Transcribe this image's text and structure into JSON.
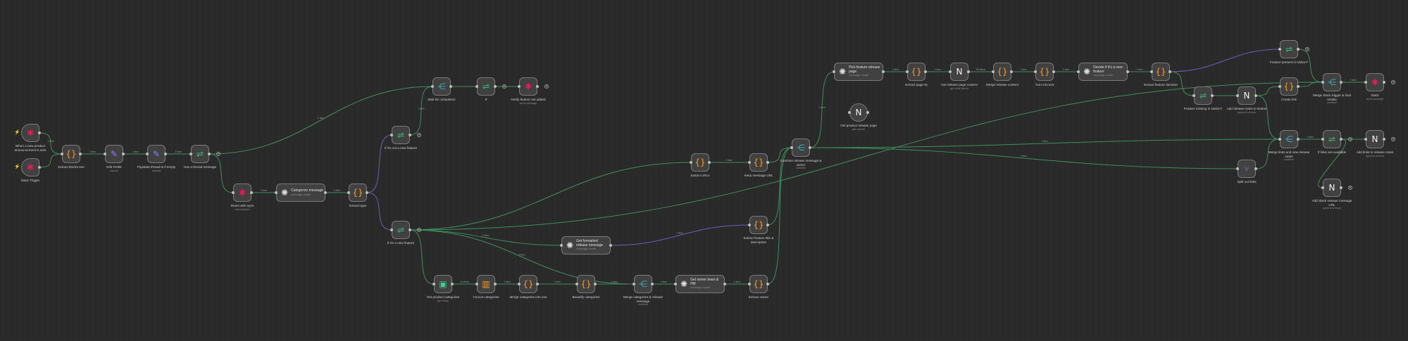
{
  "canvas": {
    "background": "#2a2a2a"
  },
  "colors": {
    "main": "#3f8f5e",
    "ai": "#6b5fb8",
    "node_border": "#7a7a7a"
  },
  "nodes": [
    {
      "id": "trig_new",
      "title": "When a new product announcement is sent",
      "icon": "slack-icon",
      "glyph": "✱",
      "color": "#e01e5a",
      "shape": "trigger"
    },
    {
      "id": "trig_slack",
      "title": "Slack Trigger",
      "icon": "slack-icon",
      "glyph": "✱",
      "color": "#e01e5a",
      "shape": "trigger"
    },
    {
      "id": "extract_blocks",
      "title": "Extract blocks text",
      "icon": "code-icon",
      "glyph": "{}",
      "color": "#ff9922"
    },
    {
      "id": "edit_fields",
      "title": "Edit Fields",
      "sub": "manual",
      "icon": "pencil-icon",
      "glyph": "✎",
      "color": "#8a7cff"
    },
    {
      "id": "populate_thread",
      "title": "Populate thread ts if empty",
      "sub": "manual",
      "icon": "pencil-icon",
      "glyph": "✎",
      "color": "#8a7cff"
    },
    {
      "id": "has_thread",
      "title": "Has a thread message",
      "icon": "if-icon",
      "glyph": "⇌",
      "color": "#35c07a"
    },
    {
      "id": "react_eyes",
      "title": "React with eyes",
      "sub": "add reaction",
      "icon": "slack-icon",
      "glyph": "✱",
      "color": "#e01e5a"
    },
    {
      "id": "categorize",
      "title": "Categorize message",
      "sub": "message model",
      "icon": "openai-icon",
      "glyph": "✺",
      "color": "#e0e0e0",
      "shape": "wide"
    },
    {
      "id": "extract_type",
      "title": "Extract type",
      "icon": "code-icon",
      "glyph": "{}",
      "color": "#ff9922"
    },
    {
      "id": "if_not_new",
      "title": "If it's not a new feature",
      "icon": "if-icon",
      "glyph": "⇌",
      "color": "#35c07a"
    },
    {
      "id": "if_new",
      "title": "If it's a new feature",
      "icon": "if-icon",
      "glyph": "⇌",
      "color": "#35c07a"
    },
    {
      "id": "wait",
      "title": "Wait for completion",
      "icon": "merge-icon",
      "glyph": "⋲",
      "color": "#35b5c0"
    },
    {
      "id": "if_plain",
      "title": "If",
      "icon": "if-icon",
      "glyph": "⇌",
      "color": "#35c07a"
    },
    {
      "id": "notify_not_added",
      "title": "Notify feature not added",
      "sub": "send message",
      "icon": "slack-icon",
      "glyph": "✱",
      "color": "#e01e5a"
    },
    {
      "id": "get_categories",
      "title": "Get product categories",
      "sub": "get many",
      "icon": "db-icon",
      "glyph": "▣",
      "color": "#3ecf8e"
    },
    {
      "id": "concat_categories",
      "title": "Concat categories",
      "icon": "aggregate-icon",
      "glyph": "▥",
      "color": "#ff9922"
    },
    {
      "id": "merge_cat_one",
      "title": "Merge categories into one",
      "icon": "code-icon",
      "glyph": "{}",
      "color": "#ff9922"
    },
    {
      "id": "beautify_categories",
      "title": "Beautify categories",
      "icon": "code-icon",
      "glyph": "{}",
      "color": "#ff9922"
    },
    {
      "id": "merge_cat_release",
      "title": "Merge categories & release message",
      "sub": "combine",
      "icon": "merge-icon",
      "glyph": "⋲",
      "color": "#35b5c0"
    },
    {
      "id": "get_formatted",
      "title": "Get formatted release message",
      "sub": "message model",
      "icon": "openai-icon",
      "glyph": "✺",
      "color": "#e0e0e0",
      "shape": "wide"
    },
    {
      "id": "get_owner",
      "title": "Get owner team & PM",
      "sub": "message model",
      "icon": "openai-icon",
      "glyph": "✺",
      "color": "#e0e0e0",
      "shape": "wide"
    },
    {
      "id": "extract_owner",
      "title": "Extract owner",
      "icon": "code-icon",
      "glyph": "{}",
      "color": "#ff9922"
    },
    {
      "id": "extract_title_desc",
      "title": "Extract feature title & description",
      "icon": "code-icon",
      "glyph": "{}",
      "color": "#ff9922"
    },
    {
      "id": "extract_urls",
      "title": "Extract URLs",
      "icon": "code-icon",
      "glyph": "{}",
      "color": "#ff9922"
    },
    {
      "id": "keep_url",
      "title": "Keep message URL",
      "icon": "code-icon",
      "glyph": "{}",
      "color": "#ff9922"
    },
    {
      "id": "combine_release",
      "title": "Combine release message & owner",
      "sub": "combine",
      "icon": "merge-icon",
      "glyph": "⋲",
      "color": "#35b5c0"
    },
    {
      "id": "pick_feature",
      "title": "Pick feature release page",
      "sub": "message model",
      "icon": "openai-icon",
      "glyph": "✺",
      "color": "#e0e0e0",
      "shape": "wide"
    },
    {
      "id": "get_product_release",
      "title": "Get product release page",
      "sub": "get a block",
      "icon": "notion-icon",
      "glyph": "N",
      "color": "#f2f2f2",
      "shape": "circle"
    },
    {
      "id": "extract_page_id",
      "title": "Extract page ID",
      "icon": "code-icon",
      "glyph": "{}",
      "color": "#ff9922"
    },
    {
      "id": "get_release_content",
      "title": "Get release page content",
      "sub": "get child blocks",
      "icon": "notion-icon",
      "glyph": "N",
      "color": "#f2f2f2"
    },
    {
      "id": "merge_release_content",
      "title": "Merge release content",
      "icon": "code-icon",
      "glyph": "{}",
      "color": "#ff9922"
    },
    {
      "id": "turn_into_text",
      "title": "Turn into text",
      "icon": "code-icon",
      "glyph": "{}",
      "color": "#ff9922"
    },
    {
      "id": "decide_new",
      "title": "Decide if it's a new feature",
      "sub": "message model",
      "icon": "openai-icon",
      "glyph": "✺",
      "color": "#e0e0e0",
      "shape": "wide"
    },
    {
      "id": "extract_decision",
      "title": "Extract feature decision",
      "icon": "code-icon",
      "glyph": "{}",
      "color": "#ff9922"
    },
    {
      "id": "feature_present",
      "title": "Feature present in Notion?",
      "icon": "if-icon",
      "glyph": "⇌",
      "color": "#35c07a"
    },
    {
      "id": "feature_missing",
      "title": "Feature missing in Notion?",
      "icon": "if-icon",
      "glyph": "⇌",
      "color": "#35c07a"
    },
    {
      "id": "add_release_notes",
      "title": "Add release notes to Notion",
      "sub": "append a block",
      "icon": "notion-icon",
      "glyph": "N",
      "color": "#f2f2f2"
    },
    {
      "id": "create_link",
      "title": "Create link",
      "icon": "code-icon",
      "glyph": "{}",
      "color": "#ff9922"
    },
    {
      "id": "merge_slack_trigger",
      "title": "Merge Slack trigger & final results",
      "sub": "combine",
      "icon": "merge-icon",
      "glyph": "⋲",
      "color": "#35b5c0"
    },
    {
      "id": "slack_final",
      "title": "Slack",
      "sub": "send message",
      "icon": "slack-icon",
      "glyph": "✱",
      "color": "#e01e5a"
    },
    {
      "id": "split_links",
      "title": "Split out links",
      "icon": "split-icon",
      "glyph": "⑂",
      "color": "#8a7cff"
    },
    {
      "id": "merge_links",
      "title": "Merge links and new release notes",
      "sub": "combine",
      "icon": "merge-icon",
      "glyph": "⋲",
      "color": "#35b5c0"
    },
    {
      "id": "if_links",
      "title": "If links are available",
      "icon": "if-icon",
      "glyph": "⇌",
      "color": "#35c07a"
    },
    {
      "id": "add_links",
      "title": "Add links to release notes",
      "sub": "append a block",
      "icon": "notion-icon",
      "glyph": "N",
      "color": "#f2f2f2"
    },
    {
      "id": "add_slack_url",
      "title": "Add Slack release message URL",
      "sub": "append a block",
      "icon": "notion-icon",
      "glyph": "N",
      "color": "#f2f2f2"
    }
  ],
  "edges": [
    {
      "from": "trig_new",
      "to": "extract_blocks",
      "label": "1 item",
      "kind": "main"
    },
    {
      "from": "trig_slack",
      "to": "extract_blocks",
      "kind": "main"
    },
    {
      "from": "extract_blocks",
      "to": "edit_fields",
      "label": "1 item",
      "kind": "main"
    },
    {
      "from": "edit_fields",
      "to": "populate_thread",
      "label": "1 item",
      "kind": "main"
    },
    {
      "from": "populate_thread",
      "to": "has_thread",
      "label": "1 item",
      "kind": "main"
    },
    {
      "from": "has_thread",
      "to": "wait",
      "label": "1 item",
      "kind": "main"
    },
    {
      "from": "has_thread",
      "to": "react_eyes",
      "kind": "main"
    },
    {
      "from": "react_eyes",
      "to": "categorize",
      "label": "1 item",
      "kind": "main"
    },
    {
      "from": "categorize",
      "to": "extract_type",
      "label": "1 item",
      "kind": "main"
    },
    {
      "from": "extract_type",
      "to": "if_not_new",
      "kind": "ai"
    },
    {
      "from": "extract_type",
      "to": "if_new",
      "kind": "ai"
    },
    {
      "from": "if_not_new",
      "to": "wait",
      "label": "1 item",
      "kind": "main"
    },
    {
      "from": "wait",
      "to": "if_plain",
      "kind": "main"
    },
    {
      "from": "if_plain",
      "to": "notify_not_added",
      "kind": "main"
    },
    {
      "from": "if_new",
      "to": "get_categories",
      "kind": "main"
    },
    {
      "from": "if_new",
      "to": "get_formatted",
      "label": "1 item",
      "kind": "main"
    },
    {
      "from": "if_new",
      "to": "merge_cat_release",
      "label": "1 item",
      "kind": "main"
    },
    {
      "from": "if_new",
      "to": "extract_urls",
      "kind": "main"
    },
    {
      "from": "if_new",
      "to": "merge_slack_trigger",
      "kind": "main"
    },
    {
      "from": "get_categories",
      "to": "concat_categories",
      "label": "11 items",
      "kind": "main"
    },
    {
      "from": "concat_categories",
      "to": "merge_cat_one",
      "label": "1 item",
      "kind": "main"
    },
    {
      "from": "merge_cat_one",
      "to": "beautify_categories",
      "label": "1 item",
      "kind": "main"
    },
    {
      "from": "beautify_categories",
      "to": "merge_cat_release",
      "label": "1 item",
      "kind": "main"
    },
    {
      "from": "merge_cat_release",
      "to": "get_owner",
      "label": "1 item",
      "kind": "main"
    },
    {
      "from": "get_owner",
      "to": "extract_owner",
      "label": "1 item",
      "kind": "main"
    },
    {
      "from": "get_formatted",
      "to": "extract_title_desc",
      "label": "1 item",
      "kind": "ai"
    },
    {
      "from": "extract_title_desc",
      "to": "combine_release",
      "kind": "main"
    },
    {
      "from": "extract_owner",
      "to": "combine_release",
      "kind": "main"
    },
    {
      "from": "extract_urls",
      "to": "keep_url",
      "label": "1 item",
      "kind": "main"
    },
    {
      "from": "keep_url",
      "to": "combine_release",
      "kind": "main"
    },
    {
      "from": "combine_release",
      "to": "pick_feature",
      "label": "1 item",
      "kind": "main"
    },
    {
      "from": "combine_release",
      "to": "merge_links",
      "label": "1 item",
      "kind": "main"
    },
    {
      "from": "combine_release",
      "to": "split_links",
      "label": "1 item",
      "kind": "main"
    },
    {
      "from": "pick_feature",
      "to": "extract_page_id",
      "label": "1 item",
      "kind": "main"
    },
    {
      "from": "extract_page_id",
      "to": "get_release_content",
      "label": "1 item",
      "kind": "main"
    },
    {
      "from": "get_release_content",
      "to": "merge_release_content",
      "label": "50 items",
      "kind": "main"
    },
    {
      "from": "merge_release_content",
      "to": "turn_into_text",
      "label": "1 item",
      "kind": "main"
    },
    {
      "from": "turn_into_text",
      "to": "decide_new",
      "label": "1 item",
      "kind": "main"
    },
    {
      "from": "decide_new",
      "to": "extract_decision",
      "label": "1 item",
      "kind": "main"
    },
    {
      "from": "extract_decision",
      "to": "feature_present",
      "kind": "ai"
    },
    {
      "from": "extract_decision",
      "to": "feature_missing",
      "kind": "main"
    },
    {
      "from": "feature_missing",
      "to": "add_release_notes",
      "kind": "main"
    },
    {
      "from": "add_release_notes",
      "to": "merge_links",
      "kind": "main"
    },
    {
      "from": "add_release_notes",
      "to": "create_link",
      "kind": "main"
    },
    {
      "from": "feature_present",
      "to": "merge_slack_trigger",
      "kind": "main"
    },
    {
      "from": "create_link",
      "to": "merge_slack_trigger",
      "kind": "main"
    },
    {
      "from": "merge_slack_trigger",
      "to": "slack_final",
      "label": "1 item",
      "kind": "main"
    },
    {
      "from": "split_links",
      "to": "merge_links",
      "kind": "main"
    },
    {
      "from": "merge_links",
      "to": "if_links",
      "label": "1 item",
      "kind": "main"
    },
    {
      "from": "if_links",
      "to": "add_links",
      "kind": "main"
    },
    {
      "from": "if_links",
      "to": "add_slack_url",
      "kind": "main"
    }
  ]
}
